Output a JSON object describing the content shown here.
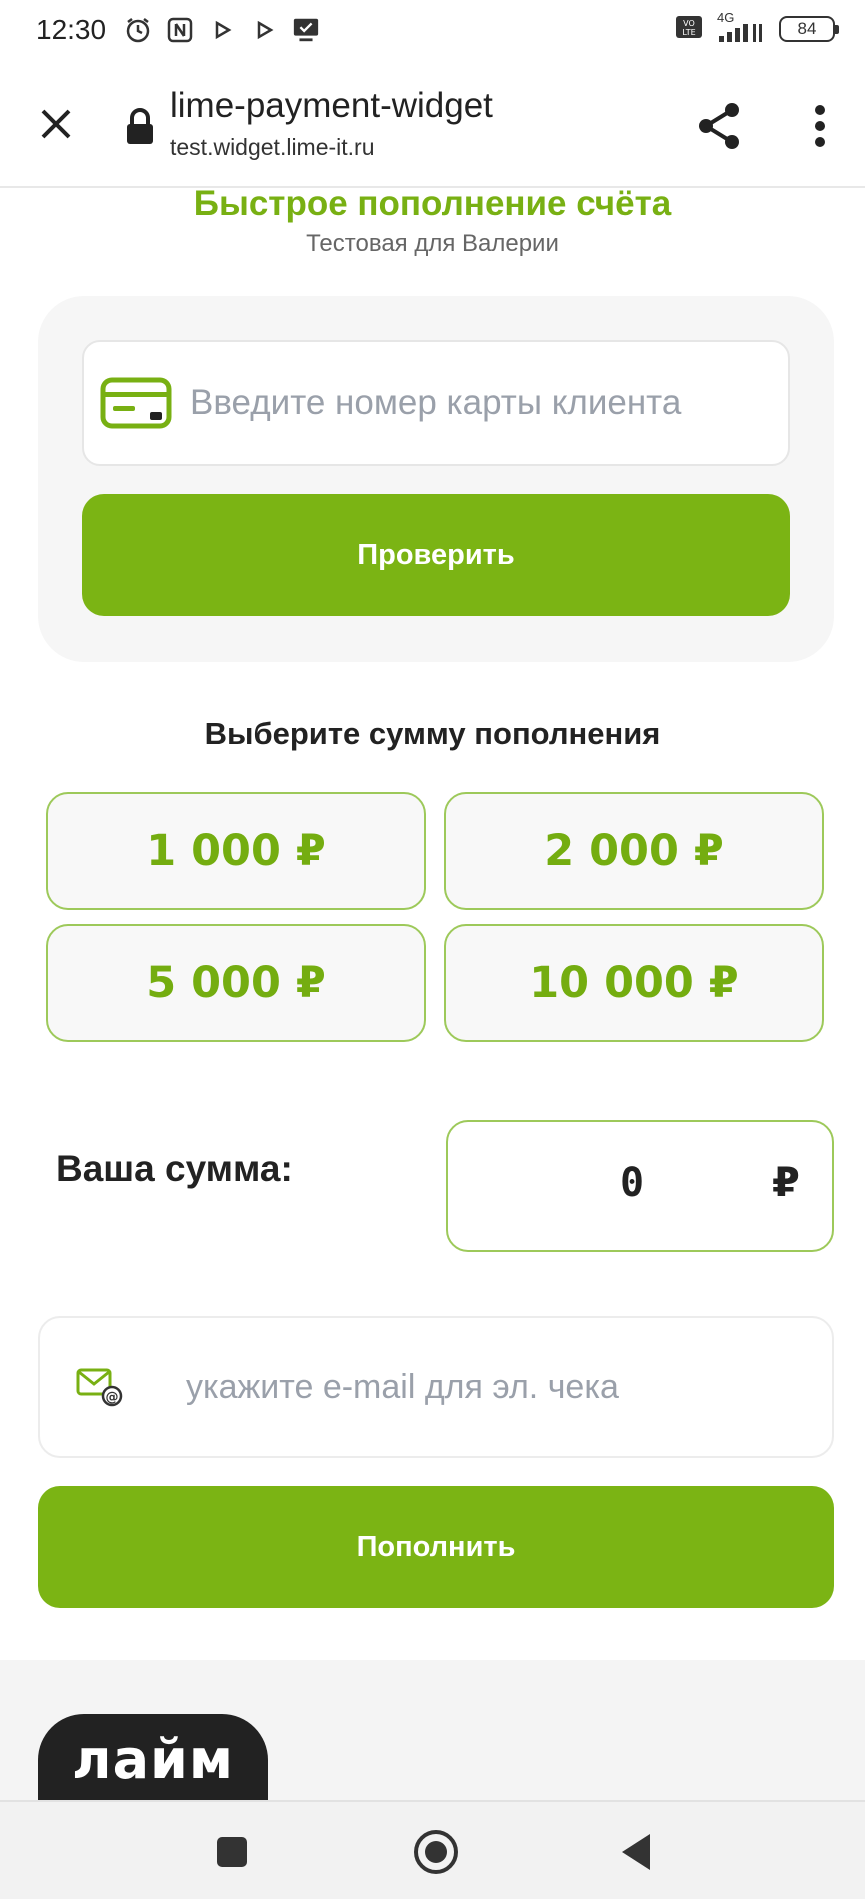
{
  "status_bar": {
    "time": "12:30",
    "network": "4G",
    "battery": "84"
  },
  "browser": {
    "title": "lime-payment-widget",
    "url": "test.widget.lime-it.ru"
  },
  "header": {
    "title": "Быстрое пополнение счёта",
    "subtitle": "Тестовая для Валерии"
  },
  "card_form": {
    "placeholder": "Введите номер карты клиента",
    "value": "",
    "check_label": "Проверить"
  },
  "amount_section": {
    "heading": "Выберите сумму пополнения",
    "options": [
      "1 000 ₽",
      "2 000 ₽",
      "5 000 ₽",
      "10 000 ₽"
    ]
  },
  "custom_sum": {
    "label": "Ваша сумма:",
    "value": "0",
    "currency": "₽"
  },
  "email_form": {
    "placeholder": "укажите e-mail для эл. чека",
    "submit_label": "Пополнить"
  },
  "footer": {
    "logo_text": "лайм"
  },
  "colors": {
    "brand_green": "#7bb414",
    "border_green": "#9dc95a"
  }
}
